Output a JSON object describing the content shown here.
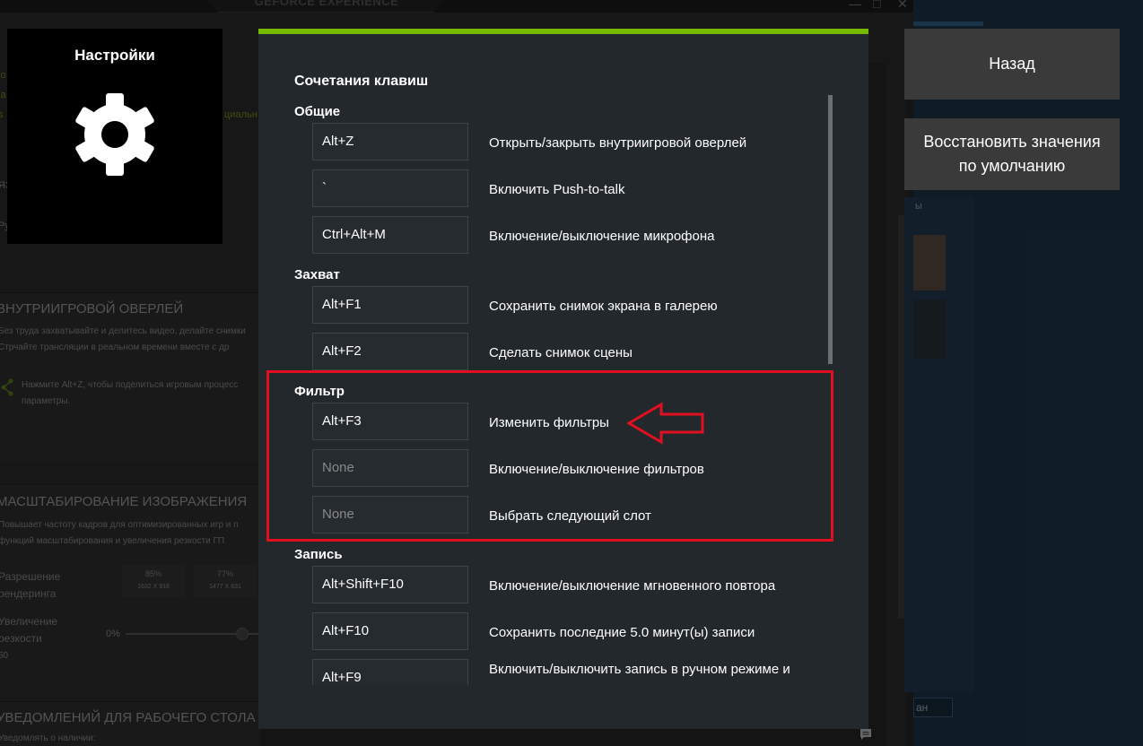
{
  "background_app": {
    "logo_text": "GEFORCE EXPERIENCE",
    "window_controls": [
      "—",
      "□",
      "✕"
    ],
    "green_fragments": [
      "lo",
      "la",
      "s",
      "циальн"
    ],
    "fragment_ya": "ЯЗ",
    "fragment_ru": "Ру",
    "overlay_panel": {
      "title": "ВНУТРИИГРОВОЙ ОВЕРЛЕЙ",
      "line1": "Без труда захватывайте и делитесь видео, делайте снимки",
      "line2": "Стрчайте трансляции в реальном времени вместе с др",
      "hint1": "Нажмите Alt+Z, чтобы поделиться игровым процесс",
      "hint2": "параметры."
    },
    "scaling_panel": {
      "title": "МАСШТАБИРОВАНИЕ ИЗОБРАЖЕНИЯ",
      "line1": "Повышает частоту кадров для оптимизированных игр и п",
      "line2": "функций масштабирования и увеличения резкости ГП",
      "render_label_1": "Разрешение",
      "render_label_2": "рендеринга",
      "res_options": [
        {
          "percent": "85%",
          "dims": "1632 X 918"
        },
        {
          "percent": "77%",
          "dims": "1477 X 831"
        }
      ],
      "sharp_label_1": "Увеличение",
      "sharp_label_2": "резкости",
      "sharp_min": "0%",
      "sharp_value": "50"
    },
    "notifications_panel": {
      "title": "УВЕДОМЛЕНИЙ ДЛЯ РАБОЧЕГО СТОЛА",
      "line1": "Уведомлять о наличии:"
    },
    "right_app": {
      "text_fragment": "ы",
      "button_fragment": "ан"
    }
  },
  "settings_badge": {
    "title": "Настройки",
    "icon": "gear-icon"
  },
  "side_buttons": {
    "back": "Назад",
    "restore_line1": "Восстановить значения",
    "restore_line2": "по умолчанию"
  },
  "modal": {
    "title": "Сочетания клавиш",
    "accent_color": "#76b900",
    "sections": [
      {
        "name": "Общие",
        "items": [
          {
            "key": "Alt+Z",
            "action": "Открыть/закрыть внутриигровой оверлей"
          },
          {
            "key": "`",
            "action": "Включить Push-to-talk"
          },
          {
            "key": "Ctrl+Alt+M",
            "action": "Включение/выключение микрофона"
          }
        ]
      },
      {
        "name": "Захват",
        "items": [
          {
            "key": "Alt+F1",
            "action": "Сохранить снимок экрана в галерею"
          },
          {
            "key": "Alt+F2",
            "action": "Сделать снимок сцены"
          }
        ]
      },
      {
        "name": "Фильтр",
        "items": [
          {
            "key": "Alt+F3",
            "action": "Изменить фильтры"
          },
          {
            "key": "None",
            "action": "Включение/выключение фильтров"
          },
          {
            "key": "None",
            "action": "Выбрать следующий слот"
          }
        ]
      },
      {
        "name": "Запись",
        "items": [
          {
            "key": "Alt+Shift+F10",
            "action": "Включение/выключение мгновенного повтора"
          },
          {
            "key": "Alt+F10",
            "action": "Сохранить последние 5.0 минут(ы) записи"
          },
          {
            "key": "Alt+F9",
            "action": "Включить/выключить запись в ручном режиме и"
          }
        ]
      }
    ]
  },
  "annotation": {
    "color": "#e01020",
    "highlighted_section": "Фильтр",
    "arrow_target": "Изменить фильтры"
  }
}
